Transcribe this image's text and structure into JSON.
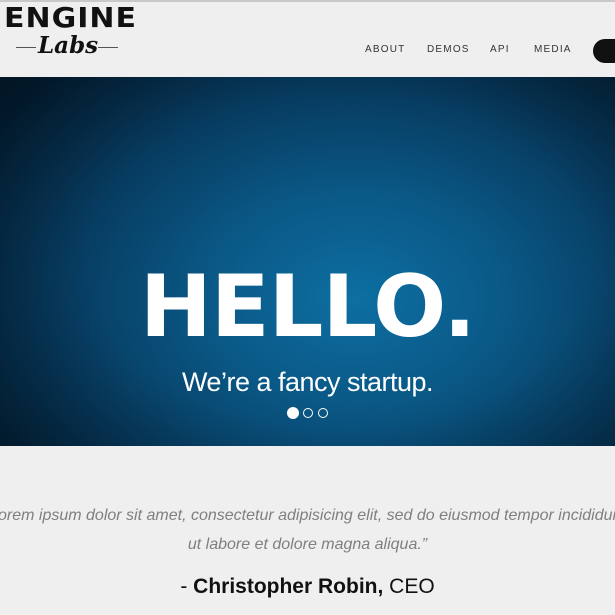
{
  "brand": {
    "name_top": "ENGINE",
    "name_bottom": "Labs"
  },
  "nav": {
    "items": [
      {
        "label": "ABOUT"
      },
      {
        "label": "DEMOS"
      },
      {
        "label": "API"
      },
      {
        "label": "MEDIA"
      }
    ]
  },
  "hero": {
    "title": "HELLO.",
    "subtitle": "We’re a fancy startup.",
    "slides_total": 3,
    "active_slide": 1
  },
  "testimonial": {
    "quote_line1": "Lorem ipsum dolor sit amet, consectetur adipisicing elit, sed do eiusmod tempor incididunt",
    "quote_line2": "ut labore et dolore magna aliqua.”",
    "author_prefix": "- ",
    "author_name": "Christopher Robin,",
    "author_role": " CEO"
  },
  "colors": {
    "hero_center": "#0d6fa2",
    "hero_edge": "#031e33",
    "page_bg": "#efefef",
    "text_dark": "#111111",
    "quote_text": "#7f7f7f"
  }
}
